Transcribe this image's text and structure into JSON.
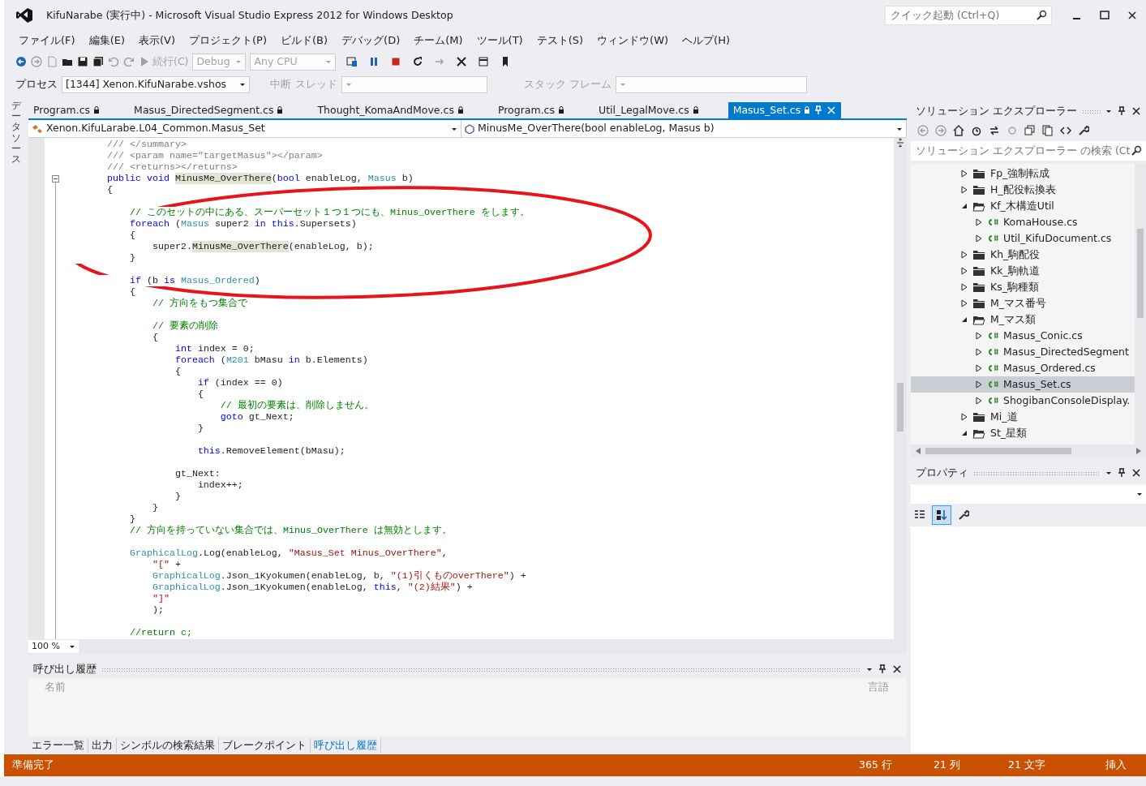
{
  "window": {
    "title": "KifuNarabe (実行中) - Microsoft Visual Studio Express 2012 for Windows Desktop",
    "quick_launch": {
      "placeholder": "クイック起動 (Ctrl+Q)"
    }
  },
  "menu": [
    "ファイル(F)",
    "編集(E)",
    "表示(V)",
    "プロジェクト(P)",
    "ビルド(B)",
    "デバッグ(D)",
    "チーム(M)",
    "ツール(T)",
    "テスト(S)",
    "ウィンドウ(W)",
    "ヘルプ(H)"
  ],
  "toolbar": {
    "continue_button": {
      "label": "続行(C)",
      "disabled": true
    },
    "configuration": {
      "value": "Debug",
      "disabled": true
    },
    "platform": {
      "value": "Any CPU",
      "disabled": true
    }
  },
  "debug_location": {
    "process_label": "プロセス",
    "process": "[1344] Xenon.KifuNarabe.vshos",
    "break_button": {
      "label": "中断",
      "disabled": true
    },
    "thread_label": "スレッド",
    "stack_frame_label": "スタック フレーム"
  },
  "side_tab": "データソース",
  "editor": {
    "tabs": [
      {
        "label": "Program.cs",
        "selected": false
      },
      {
        "label": "Masus_DirectedSegment.cs",
        "selected": false
      },
      {
        "label": "Thought_KomaAndMove.cs",
        "selected": false
      },
      {
        "label": "Program.cs",
        "selected": false
      },
      {
        "label": "Util_LegalMove.cs",
        "selected": false
      },
      {
        "label": "Masus_Set.cs",
        "selected": true
      }
    ],
    "class_dropdown": "Xenon.KifuLarabe.L04_Common.Masus_Set",
    "member_dropdown": "MinusMe_OverThere(bool enableLog, Masus b)",
    "lines": [
      {
        "kind": "code",
        "tokens": [
          {
            "text": "        /// </summary>",
            "kind": "xml"
          }
        ]
      },
      {
        "kind": "code",
        "tokens": [
          {
            "text": "        /// <param name=\"targetMasus\"></param>",
            "kind": "xml"
          }
        ]
      },
      {
        "kind": "code",
        "tokens": [
          {
            "text": "        /// <returns></returns>",
            "kind": "xml"
          }
        ]
      },
      {
        "kind": "code",
        "foldable": true,
        "tokens": [
          {
            "text": "        public void ",
            "kind": "kw"
          },
          {
            "text": "MinusMe_OverThere",
            "kind": "ref"
          },
          {
            "text": "(",
            "kind": "plain"
          },
          {
            "text": "bool",
            "kind": "kw"
          },
          {
            "text": " enableLog, ",
            "kind": "plain"
          },
          {
            "text": "Masus",
            "kind": "type"
          },
          {
            "text": " b)",
            "kind": "plain"
          }
        ]
      },
      {
        "kind": "code",
        "tokens": [
          {
            "text": "        {",
            "kind": "plain"
          }
        ]
      },
      {
        "kind": "blank"
      },
      {
        "kind": "code",
        "tokens": [
          {
            "text": "            // このセットの中にある、スーパーセット１つ１つにも、Minus_OverThere をします。",
            "kind": "cmt"
          }
        ]
      },
      {
        "kind": "code",
        "tokens": [
          {
            "text": "            foreach",
            "kind": "kw"
          },
          {
            "text": " (",
            "kind": "plain"
          },
          {
            "text": "Masus",
            "kind": "type"
          },
          {
            "text": " super2 ",
            "kind": "plain"
          },
          {
            "text": "in this",
            "kind": "kw"
          },
          {
            "text": ".Supersets)",
            "kind": "plain"
          }
        ]
      },
      {
        "kind": "code",
        "tokens": [
          {
            "text": "            {",
            "kind": "plain"
          }
        ]
      },
      {
        "kind": "code",
        "tokens": [
          {
            "text": "                super2.",
            "kind": "plain"
          },
          {
            "text": "MinusMe_OverThere",
            "kind": "ref"
          },
          {
            "text": "(enableLog, b);",
            "kind": "plain"
          }
        ]
      },
      {
        "kind": "code",
        "tokens": [
          {
            "text": "            }",
            "kind": "plain"
          }
        ]
      },
      {
        "kind": "blank"
      },
      {
        "kind": "code",
        "tokens": [
          {
            "text": "            if",
            "kind": "kw"
          },
          {
            "text": " (b ",
            "kind": "plain"
          },
          {
            "text": "is",
            "kind": "kw"
          },
          {
            "text": " Masus_Ordered",
            "kind": "type"
          },
          {
            "text": ")",
            "kind": "plain"
          }
        ]
      },
      {
        "kind": "code",
        "tokens": [
          {
            "text": "            {",
            "kind": "plain"
          }
        ]
      },
      {
        "kind": "code",
        "tokens": [
          {
            "text": "                // 方向をもつ集合で",
            "kind": "cmt"
          }
        ]
      },
      {
        "kind": "blank"
      },
      {
        "kind": "code",
        "tokens": [
          {
            "text": "                // 要素の削除",
            "kind": "cmt"
          }
        ]
      },
      {
        "kind": "code",
        "tokens": [
          {
            "text": "                {",
            "kind": "plain"
          }
        ]
      },
      {
        "kind": "code",
        "tokens": [
          {
            "text": "                    int",
            "kind": "kw"
          },
          {
            "text": " index = 0;",
            "kind": "plain"
          }
        ]
      },
      {
        "kind": "code",
        "tokens": [
          {
            "text": "                    foreach",
            "kind": "kw"
          },
          {
            "text": " (",
            "kind": "plain"
          },
          {
            "text": "M201",
            "kind": "type"
          },
          {
            "text": " bMasu ",
            "kind": "plain"
          },
          {
            "text": "in",
            "kind": "kw"
          },
          {
            "text": " b.Elements)",
            "kind": "plain"
          }
        ]
      },
      {
        "kind": "code",
        "tokens": [
          {
            "text": "                    {",
            "kind": "plain"
          }
        ]
      },
      {
        "kind": "code",
        "tokens": [
          {
            "text": "                        if",
            "kind": "kw"
          },
          {
            "text": " (index == 0)",
            "kind": "plain"
          }
        ]
      },
      {
        "kind": "code",
        "tokens": [
          {
            "text": "                        {",
            "kind": "plain"
          }
        ]
      },
      {
        "kind": "code",
        "tokens": [
          {
            "text": "                            // 最初の要素は、削除しません。",
            "kind": "cmt"
          }
        ]
      },
      {
        "kind": "code",
        "tokens": [
          {
            "text": "                            goto",
            "kind": "kw"
          },
          {
            "text": " gt_Next;",
            "kind": "plain"
          }
        ]
      },
      {
        "kind": "code",
        "tokens": [
          {
            "text": "                        }",
            "kind": "plain"
          }
        ]
      },
      {
        "kind": "blank"
      },
      {
        "kind": "code",
        "tokens": [
          {
            "text": "                        this",
            "kind": "kw"
          },
          {
            "text": ".RemoveElement(bMasu);",
            "kind": "plain"
          }
        ]
      },
      {
        "kind": "blank"
      },
      {
        "kind": "code",
        "tokens": [
          {
            "text": "                    gt_Next:",
            "kind": "plain"
          }
        ]
      },
      {
        "kind": "code",
        "tokens": [
          {
            "text": "                        index++;",
            "kind": "plain"
          }
        ]
      },
      {
        "kind": "code",
        "tokens": [
          {
            "text": "                    }",
            "kind": "plain"
          }
        ]
      },
      {
        "kind": "code",
        "tokens": [
          {
            "text": "                }",
            "kind": "plain"
          }
        ]
      },
      {
        "kind": "code",
        "tokens": [
          {
            "text": "            }",
            "kind": "plain"
          }
        ]
      },
      {
        "kind": "code",
        "tokens": [
          {
            "text": "            // 方向を持っていない集合では、Minus_OverThere は無効とします。",
            "kind": "cmt"
          }
        ]
      },
      {
        "kind": "blank"
      },
      {
        "kind": "code",
        "tokens": [
          {
            "text": "            GraphicalLog",
            "kind": "type"
          },
          {
            "text": ".Log(enableLog, ",
            "kind": "plain"
          },
          {
            "text": "\"Masus_Set Minus_OverThere\"",
            "kind": "str"
          },
          {
            "text": ",",
            "kind": "plain"
          }
        ]
      },
      {
        "kind": "code",
        "tokens": [
          {
            "text": "                \"[\"",
            "kind": "str"
          },
          {
            "text": " +",
            "kind": "plain"
          }
        ]
      },
      {
        "kind": "code",
        "tokens": [
          {
            "text": "                GraphicalLog",
            "kind": "type"
          },
          {
            "text": ".Json_1Kyokumen(enableLog, b, ",
            "kind": "plain"
          },
          {
            "text": "\"(1)引くものoverThere\"",
            "kind": "str"
          },
          {
            "text": ") +",
            "kind": "plain"
          }
        ]
      },
      {
        "kind": "code",
        "tokens": [
          {
            "text": "                GraphicalLog",
            "kind": "type"
          },
          {
            "text": ".Json_1Kyokumen(enableLog, ",
            "kind": "plain"
          },
          {
            "text": "this",
            "kind": "kw"
          },
          {
            "text": ", ",
            "kind": "plain"
          },
          {
            "text": "\"(2)結果\"",
            "kind": "str"
          },
          {
            "text": ") +",
            "kind": "plain"
          }
        ]
      },
      {
        "kind": "code",
        "tokens": [
          {
            "text": "                \"]\"",
            "kind": "str"
          }
        ]
      },
      {
        "kind": "code",
        "tokens": [
          {
            "text": "                );",
            "kind": "plain"
          }
        ]
      },
      {
        "kind": "blank"
      },
      {
        "kind": "code",
        "tokens": [
          {
            "text": "            //return c;",
            "kind": "cmt"
          }
        ]
      }
    ],
    "annotation": {
      "kind": "ellipse",
      "color": "#e8141b"
    },
    "zoom": "100 %"
  },
  "call_stack": {
    "title": "呼び出し履歴",
    "columns": [
      "名前",
      "言語"
    ]
  },
  "bottom_tabs": [
    {
      "label": "エラー一覧",
      "selected": false
    },
    {
      "label": "出力",
      "selected": false
    },
    {
      "label": "シンボルの検索結果",
      "selected": false
    },
    {
      "label": "ブレークポイント",
      "selected": false
    },
    {
      "label": "呼び出し履歴",
      "selected": true
    }
  ],
  "solution_explorer": {
    "title": "ソリューション エクスプローラー",
    "search": {
      "placeholder": "ソリューション エクスプローラー の検索 (Ct"
    },
    "items": [
      {
        "label": "Fp_強制転成",
        "kind": "folder",
        "expanded": false,
        "selected": false
      },
      {
        "label": "H_配役転換表",
        "kind": "folder",
        "expanded": false,
        "selected": false
      },
      {
        "label": "Kf_木構造Util",
        "kind": "folder",
        "expanded": true,
        "selected": false,
        "children": [
          {
            "label": "KomaHouse.cs",
            "kind": "file",
            "expanded": false,
            "selected": false
          },
          {
            "label": "Util_KifuDocument.cs",
            "kind": "file",
            "expanded": false,
            "selected": false
          }
        ]
      },
      {
        "label": "Kh_駒配役",
        "kind": "folder",
        "expanded": false,
        "selected": false
      },
      {
        "label": "Kk_駒軌道",
        "kind": "folder",
        "expanded": false,
        "selected": false
      },
      {
        "label": "Ks_駒種類",
        "kind": "folder",
        "expanded": false,
        "selected": false
      },
      {
        "label": "M_マス番号",
        "kind": "folder",
        "expanded": false,
        "selected": false
      },
      {
        "label": "M_マス類",
        "kind": "folder",
        "expanded": true,
        "selected": false,
        "children": [
          {
            "label": "Masus_Conic.cs",
            "kind": "file",
            "expanded": false,
            "selected": false
          },
          {
            "label": "Masus_DirectedSegment",
            "kind": "file",
            "expanded": false,
            "selected": false
          },
          {
            "label": "Masus_Ordered.cs",
            "kind": "file",
            "expanded": false,
            "selected": false
          },
          {
            "label": "Masus_Set.cs",
            "kind": "file",
            "expanded": false,
            "selected": true
          },
          {
            "label": "ShogibanConsoleDisplay.",
            "kind": "file",
            "expanded": false,
            "selected": false
          }
        ]
      },
      {
        "label": "Mi_道",
        "kind": "folder",
        "expanded": false,
        "selected": false
      },
      {
        "label": "St_星類",
        "kind": "folder",
        "expanded": true,
        "selected": false
      }
    ]
  },
  "properties": {
    "title": "プロパティ",
    "alphabetical": true
  },
  "status_bar": {
    "message": "準備完了",
    "line": "365 行",
    "column": "21 列",
    "char": "21 文字",
    "mode": "挿入"
  }
}
